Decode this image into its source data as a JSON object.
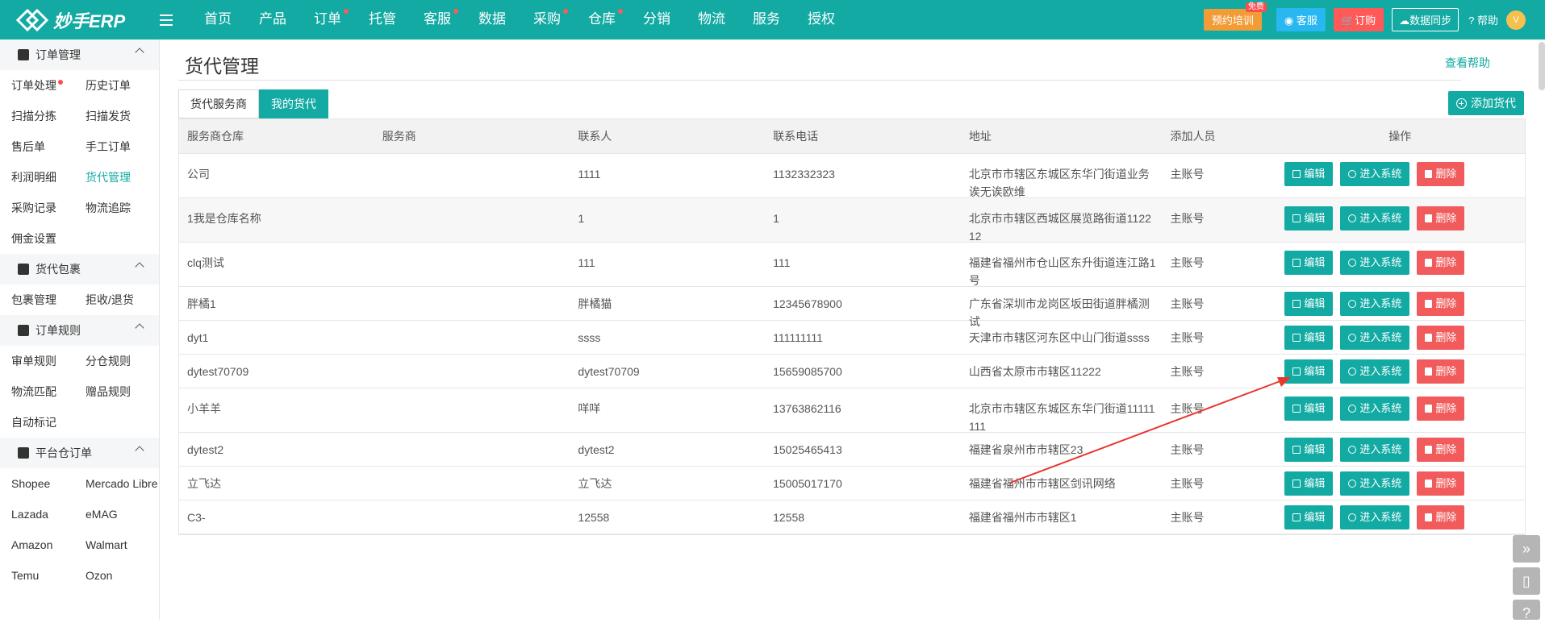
{
  "header": {
    "logo_text": "妙手ERP",
    "nav": [
      {
        "label": "首页",
        "dot": false
      },
      {
        "label": "产品",
        "dot": false
      },
      {
        "label": "订单",
        "dot": true
      },
      {
        "label": "托管",
        "dot": false
      },
      {
        "label": "客服",
        "dot": true
      },
      {
        "label": "数据",
        "dot": false
      },
      {
        "label": "采购",
        "dot": true
      },
      {
        "label": "仓库",
        "dot": true
      },
      {
        "label": "分销",
        "dot": false
      },
      {
        "label": "物流",
        "dot": false
      },
      {
        "label": "服务",
        "dot": false
      },
      {
        "label": "授权",
        "dot": false
      }
    ],
    "train_label": "预约培训",
    "train_badge": "免费",
    "kefu_label": "客服",
    "order_label": "订购",
    "sync_label": "数据同步",
    "help_label": "帮助",
    "avatar_text": "V"
  },
  "sidebar": {
    "groups": [
      {
        "title": "订单管理",
        "items": [
          "订单处理",
          "历史订单",
          "扫描分拣",
          "扫描发货",
          "售后单",
          "手工订单",
          "利润明细",
          "货代管理",
          "采购记录",
          "物流追踪",
          "佣金设置"
        ]
      },
      {
        "title": "货代包裹",
        "items": [
          "包裹管理",
          "拒收/退货"
        ]
      },
      {
        "title": "订单规则",
        "items": [
          "审单规则",
          "分仓规则",
          "物流匹配",
          "赠品规则",
          "自动标记"
        ]
      },
      {
        "title": "平台仓订单",
        "items": [
          "Shopee",
          "Mercado Libre",
          "Lazada",
          "eMAG",
          "Amazon",
          "Walmart",
          "Temu",
          "Ozon"
        ]
      }
    ],
    "active_item": "货代管理"
  },
  "main": {
    "title": "货代管理",
    "help_link": "查看帮助",
    "tabs": [
      "货代服务商",
      "我的货代"
    ],
    "add_button": "添加货代",
    "columns": [
      "服务商仓库",
      "服务商",
      "联系人",
      "联系电话",
      "地址",
      "添加人员",
      "操作"
    ],
    "ops": {
      "edit": "编辑",
      "enter": "进入系统",
      "delete": "删除"
    },
    "rows": [
      {
        "warehouse": "公司",
        "provider": "",
        "contact": "1111",
        "phone": "1132332323",
        "address": "北京市市辖区东城区东华门街道业务诶无诶欧维",
        "adder": "主账号"
      },
      {
        "warehouse": "1我是仓库名称",
        "provider": "",
        "contact": "1",
        "phone": "1",
        "address": "北京市市辖区西城区展览路街道112212",
        "adder": "主账号"
      },
      {
        "warehouse": "clq测试",
        "provider": "",
        "contact": "111",
        "phone": "111",
        "address": "福建省福州市仓山区东升街道连江路1号",
        "adder": "主账号"
      },
      {
        "warehouse": "胖橘1",
        "provider": "",
        "contact": "胖橘猫",
        "phone": "12345678900",
        "address": "广东省深圳市龙岗区坂田街道胖橘测试",
        "adder": "主账号"
      },
      {
        "warehouse": "dyt1",
        "provider": "",
        "contact": "ssss",
        "phone": "111111111",
        "address": "天津市市辖区河东区中山门街道ssss",
        "adder": "主账号"
      },
      {
        "warehouse": "dytest70709",
        "provider": "",
        "contact": "dytest70709",
        "phone": "15659085700",
        "address": "山西省太原市市辖区11222",
        "adder": "主账号"
      },
      {
        "warehouse": "小羊羊",
        "provider": "",
        "contact": "咩咩",
        "phone": "13763862116",
        "address": "北京市市辖区东城区东华门街道11111111",
        "adder": "主账号"
      },
      {
        "warehouse": "dytest2",
        "provider": "",
        "contact": "dytest2",
        "phone": "15025465413",
        "address": "福建省泉州市市辖区23",
        "adder": "主账号"
      },
      {
        "warehouse": "立飞达",
        "provider": "",
        "contact": "立飞达",
        "phone": "15005017170",
        "address": "福建省福州市市辖区剑讯网络",
        "adder": "主账号"
      },
      {
        "warehouse": "C3-",
        "provider": "",
        "contact": "12558",
        "phone": "12558",
        "address": "福建省福州市市辖区1",
        "adder": "主账号"
      }
    ]
  },
  "colors": {
    "primary": "#12aaa3",
    "danger": "#f15b5b",
    "annotation": "#e8372d"
  }
}
